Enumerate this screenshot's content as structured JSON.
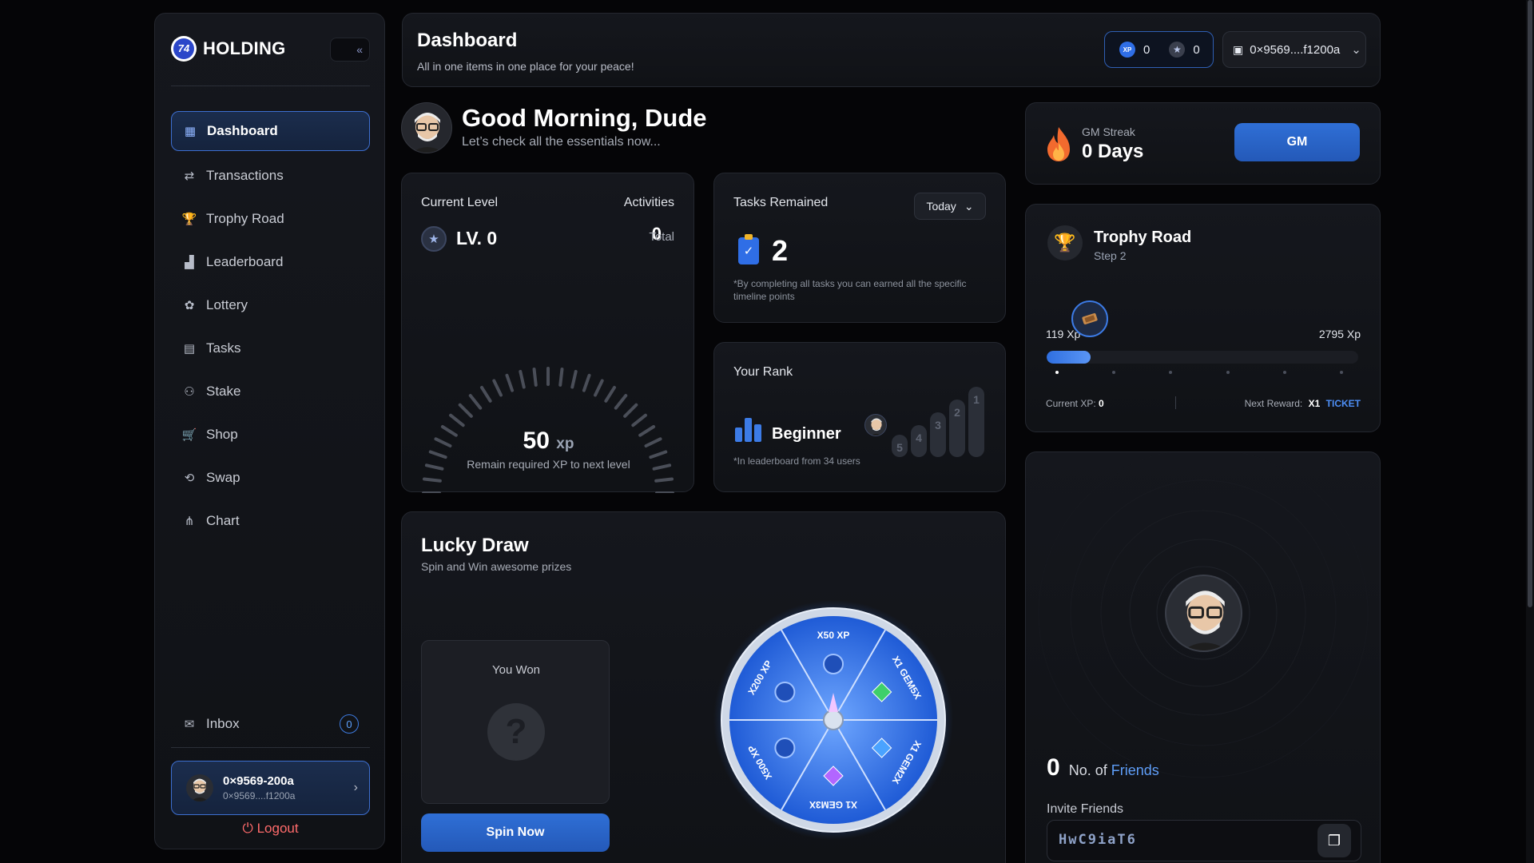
{
  "sidebar": {
    "brand": "HOLDING",
    "brand_mark": "74",
    "collapse_icon": "«",
    "items": [
      {
        "label": "Dashboard",
        "icon": "grid-icon",
        "glyph": "▦",
        "active": true
      },
      {
        "label": "Transactions",
        "icon": "transactions-icon",
        "glyph": "⇄"
      },
      {
        "label": "Trophy Road",
        "icon": "trophy-icon",
        "glyph": "🏆"
      },
      {
        "label": "Leaderboard",
        "icon": "leaderboard-icon",
        "glyph": "▟"
      },
      {
        "label": "Lottery",
        "icon": "lottery-icon",
        "glyph": "✿"
      },
      {
        "label": "Tasks",
        "icon": "tasks-icon",
        "glyph": "▤"
      },
      {
        "label": "Stake",
        "icon": "stake-icon",
        "glyph": "⚇"
      },
      {
        "label": "Shop",
        "icon": "cart-icon",
        "glyph": "🛒"
      },
      {
        "label": "Swap",
        "icon": "swap-icon",
        "glyph": "⟲"
      },
      {
        "label": "Chart",
        "icon": "chart-icon",
        "glyph": "⋔"
      }
    ],
    "inbox": {
      "label": "Inbox",
      "count": "0"
    },
    "user": {
      "name": "0×9569-200a",
      "address": "0×9569....f1200a"
    },
    "logout": "Logout"
  },
  "header": {
    "title": "Dashboard",
    "subtitle": "All in one items in one place for your peace!",
    "xp_points": "0",
    "star_points": "0",
    "xp_badge": "XP",
    "wallet": "0×9569....f1200a"
  },
  "greeting": {
    "title": "Good Morning, Dude",
    "subtitle": "Let’s check all the essentials now..."
  },
  "level": {
    "label": "Current Level",
    "level": "LV. 0",
    "activities_label": "Activities",
    "activities_count": "0",
    "activities_suffix": "Total",
    "xp_value": "50",
    "xp_unit": "xp",
    "caption": "Remain required XP to next level"
  },
  "tasks": {
    "label": "Tasks Remained",
    "filter": "Today",
    "count": "2",
    "note": "*By completing all tasks you can earned all the specific timeline points"
  },
  "rank": {
    "label": "Your Rank",
    "name": "Beginner",
    "note": "*In leaderboard from 34 users",
    "podium": [
      "5",
      "4",
      "3",
      "2",
      "1"
    ]
  },
  "gm": {
    "label": "GM Streak",
    "days": "0 Days",
    "button": "GM"
  },
  "trophy": {
    "title": "Trophy Road",
    "step": "Step 2",
    "xp_start": "119 Xp",
    "xp_end": "2795 Xp",
    "progress": 0.14,
    "current_xp_label": "Current XP:",
    "current_xp": "0",
    "next_reward_label": "Next Reward:",
    "next_reward_qty": "X1",
    "next_reward_item": "TICKET"
  },
  "friends": {
    "count": "0",
    "label_no": "No. of",
    "label_friends": "Friends",
    "invite_label": "Invite Friends",
    "invite_code": "HwC9iaT6"
  },
  "lucky": {
    "title": "Lucky Draw",
    "subtitle": "Spin and Win awesome prizes",
    "won_label": "You Won",
    "won_placeholder": "?",
    "button": "Spin Now",
    "segments": [
      "X50 XP",
      "X1 GEM5X",
      "X1 GEM2X",
      "X1 GEM3X",
      "X500 XP",
      "X200 XP"
    ]
  },
  "colors": {
    "accent": "#2f6fd6",
    "background": "#050507",
    "card": "#15171d",
    "logout": "#ff6b6b"
  }
}
